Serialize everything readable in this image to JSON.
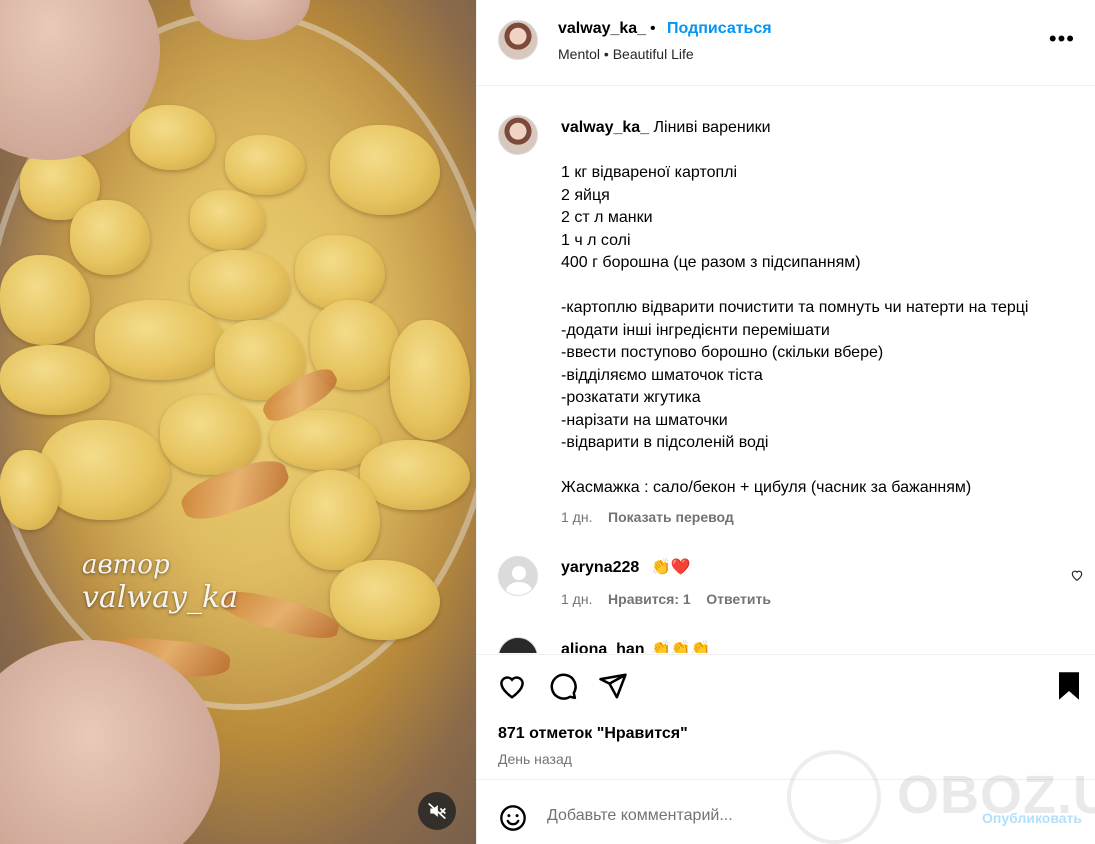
{
  "header": {
    "username": "valway_ka_",
    "dot": "•",
    "follow_label": "Подписаться",
    "music": "Mentol • Beautiful Life",
    "more_label": "•••"
  },
  "media": {
    "watermark_line1": "автор",
    "watermark_line2": "valway_ka",
    "mute_icon": "speaker-muted-icon"
  },
  "caption": {
    "username": "valway_ka_",
    "title": "Ліниві вареники",
    "lines": [
      "",
      "1 кг відвареної картоплі",
      "2 яйця",
      "2 ст л манки",
      "1 ч л солі",
      "400 г борошна (це разом з підсипанням)",
      "",
      "-картоплю відварити почистити та помнуть чи натерти на терці",
      "-додати інші інгредієнти перемішати",
      "-ввести поступово борошно (скільки вбере)",
      "-відділяємо шматочок тіста",
      "-розкатати жгутика",
      "-нарізати на шматочки",
      "-відварити в підсоленій воді",
      "",
      "Жасмажка : сало/бекон + цибуля (часник за бажанням)"
    ],
    "time": "1 дн.",
    "translate_label": "Показать перевод"
  },
  "comments": [
    {
      "username": "yaryna228",
      "emoji": "👏❤️",
      "time": "1 дн.",
      "likes": "Нравится: 1",
      "reply_label": "Ответить"
    },
    {
      "username": "aliona_han",
      "emoji": "👏👏👏"
    }
  ],
  "actions": {
    "likes_text": "871 отметок \"Нравится\"",
    "when": "День назад"
  },
  "add_comment": {
    "placeholder": "Добавьте комментарий...",
    "publish_label": "Опубликовать"
  },
  "site_watermark": "OBOZ.UA",
  "colors": {
    "accent": "#0095f6",
    "publish_disabled": "#b2dffc",
    "muted_text": "#737373"
  }
}
